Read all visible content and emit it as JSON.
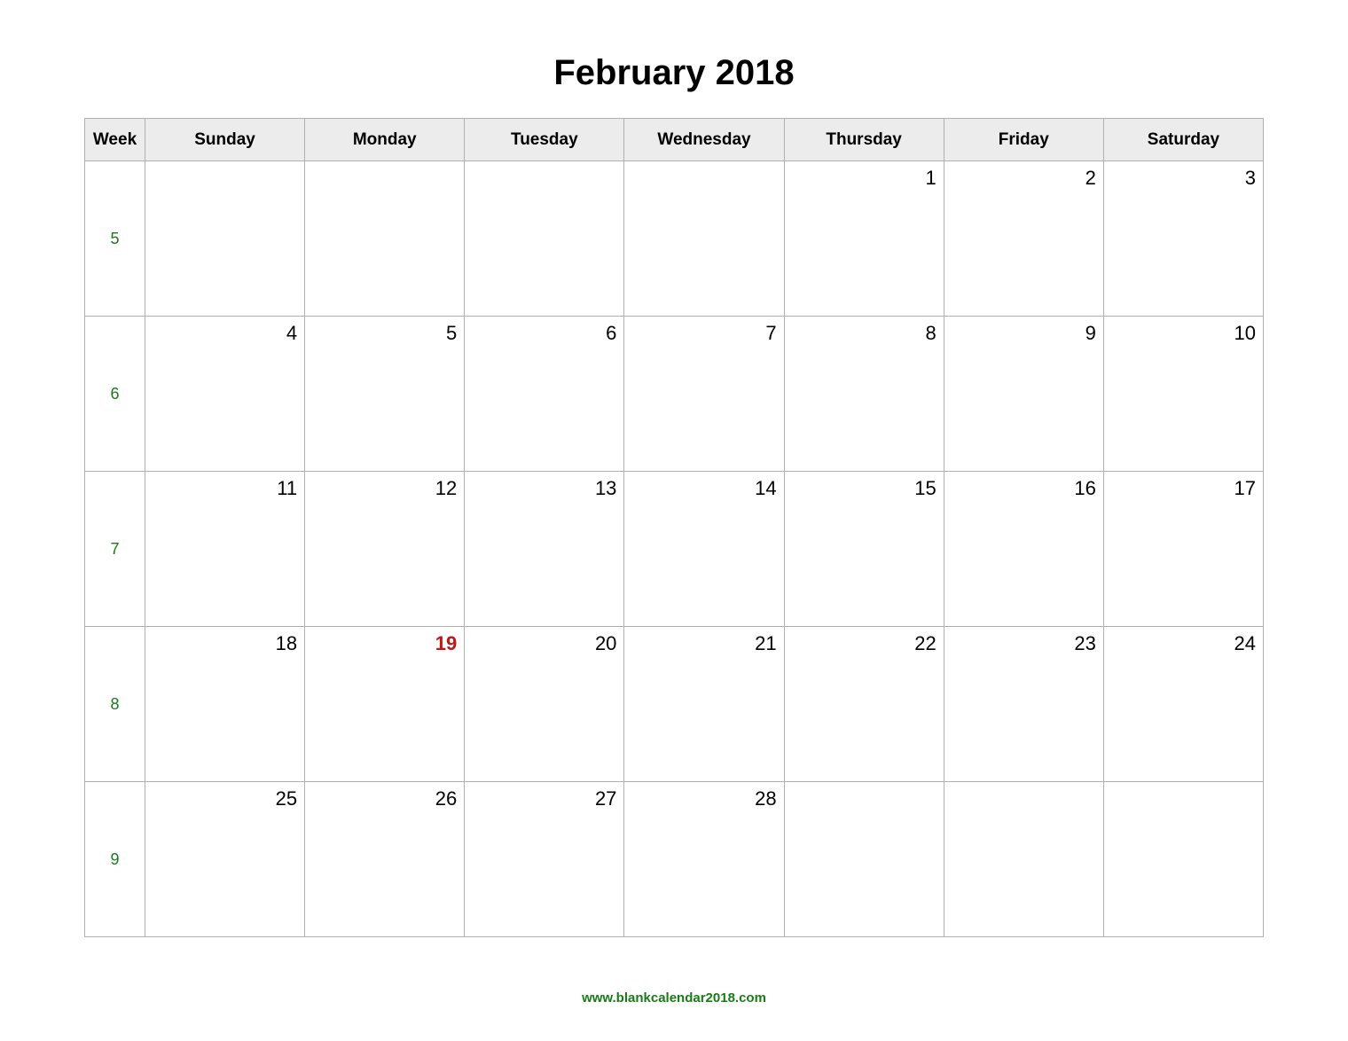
{
  "title": "February 2018",
  "header": {
    "week": "Week",
    "days": [
      "Sunday",
      "Monday",
      "Tuesday",
      "Wednesday",
      "Thursday",
      "Friday",
      "Saturday"
    ]
  },
  "rows": [
    {
      "week": "5",
      "days": [
        "",
        "",
        "",
        "",
        "1",
        "2",
        "3"
      ],
      "holiday_index": -1
    },
    {
      "week": "6",
      "days": [
        "4",
        "5",
        "6",
        "7",
        "8",
        "9",
        "10"
      ],
      "holiday_index": -1
    },
    {
      "week": "7",
      "days": [
        "11",
        "12",
        "13",
        "14",
        "15",
        "16",
        "17"
      ],
      "holiday_index": -1
    },
    {
      "week": "8",
      "days": [
        "18",
        "19",
        "20",
        "21",
        "22",
        "23",
        "24"
      ],
      "holiday_index": 1
    },
    {
      "week": "9",
      "days": [
        "25",
        "26",
        "27",
        "28",
        "",
        "",
        ""
      ],
      "holiday_index": -1
    }
  ],
  "footer": "www.blankcalendar2018.com"
}
